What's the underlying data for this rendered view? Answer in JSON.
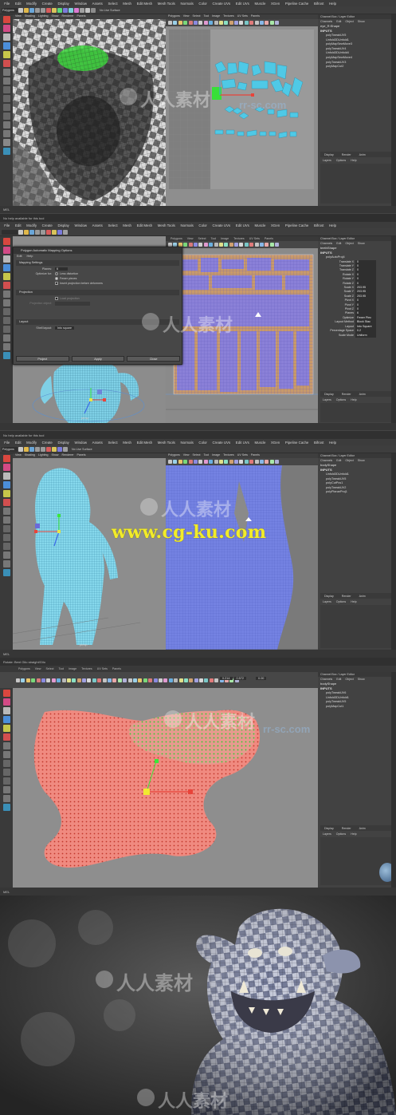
{
  "panel1": {
    "menus": [
      "File",
      "Edit",
      "Modify",
      "Create",
      "Display",
      "Window",
      "Assets",
      "Select",
      "Mesh",
      "Edit Mesh",
      "Mesh Tools",
      "Normals",
      "Color",
      "Create UVs",
      "Edit UVs",
      "Muscle",
      "XGen",
      "Pipeline Cache",
      "Bifrost",
      "Help"
    ],
    "mode_dropdown": "Polygons",
    "live_surface": "No Live Surface",
    "viewport_menus": [
      "View",
      "Shading",
      "Lighting",
      "Show",
      "Renderer",
      "Panels"
    ],
    "uv_menus": [
      "Polygons",
      "View",
      "Select",
      "Tool",
      "Image",
      "Textures",
      "UV Sets",
      "Panels"
    ],
    "channel_title": "Channel Box / Layer Editor",
    "channel_menus": [
      "Channels",
      "Edit",
      "Object",
      "Show"
    ],
    "object_name": "eye_R:Shape",
    "inputs_label": "INPUTS",
    "inputs": [
      "polyTweakUV5",
      "Unfold3DUnfold1",
      "polyMapSewMove3",
      "polyTweakUV4",
      "Unfold3DUnfold4",
      "polyMapSewMove4",
      "polyTweakUV3",
      "polyMapCut2"
    ],
    "layer_tabs": [
      "Display",
      "Render",
      "Anim"
    ],
    "layer_menus": [
      "Layers",
      "Options",
      "Help"
    ],
    "camera_label": "persp",
    "help_line": "No help available for this tool",
    "mel_label": "MEL"
  },
  "panel2": {
    "menus": [
      "File",
      "Edit",
      "Modify",
      "Create",
      "Display",
      "Window",
      "Assets",
      "Select",
      "Mesh",
      "Edit Mesh",
      "Mesh Tools",
      "Normals",
      "Color",
      "Create UVs",
      "Edit UVs",
      "Muscle",
      "XGen",
      "Pipeline Cache",
      "Bifrost",
      "Help"
    ],
    "dialog": {
      "title": "Polygon Automatic Mapping Options",
      "menus": [
        "Edit",
        "Help"
      ],
      "sections": [
        "Mapping Settings",
        "Projection",
        "Layout"
      ],
      "planes_label": "Planes:",
      "planes_value": "6",
      "optimize_label": "Optimize for:",
      "opt_less": "Less distortion",
      "opt_fewer": "Fewer pieces",
      "insert_label": "Insert projection before deformers",
      "load_projection": "Load projection",
      "projection_object": "Projection object:",
      "shell_layout_label": "Shell layout:",
      "shell_layout_value": "Into square",
      "buttons": [
        "Project",
        "Apply",
        "Close"
      ]
    },
    "object_name": "teethShape",
    "inputs_label": "INPUTS",
    "node": "polyAutoProj4",
    "attributes": [
      {
        "name": "Translate X",
        "value": "0"
      },
      {
        "name": "Translate Y",
        "value": "0"
      },
      {
        "name": "Translate Z",
        "value": "0"
      },
      {
        "name": "Rotate X",
        "value": "0"
      },
      {
        "name": "Rotate Y",
        "value": "0"
      },
      {
        "name": "Rotate Z",
        "value": "0"
      },
      {
        "name": "Scale X",
        "value": "203.95"
      },
      {
        "name": "Scale Y",
        "value": "203.95"
      },
      {
        "name": "Scale Z",
        "value": "203.95"
      },
      {
        "name": "Pivot X",
        "value": "0"
      },
      {
        "name": "Pivot Y",
        "value": "0"
      },
      {
        "name": "Pivot Z",
        "value": "0"
      },
      {
        "name": "Planes",
        "value": "6"
      },
      {
        "name": "Optimize",
        "value": "Fewer Piec"
      },
      {
        "name": "Layout Method",
        "value": "Block Stac"
      },
      {
        "name": "Layout",
        "value": "Into Square"
      },
      {
        "name": "Percentage Space",
        "value": "0.2"
      },
      {
        "name": "Scale Mode",
        "value": "Uniform"
      }
    ],
    "layer_tabs": [
      "Display",
      "Render",
      "Anim"
    ],
    "layer_menus": [
      "Layers",
      "Options",
      "Help"
    ],
    "camera_label": "persp",
    "help_line": "No help available for this tool"
  },
  "panel3": {
    "menus": [
      "File",
      "Edit",
      "Modify",
      "Create",
      "Display",
      "Window",
      "Assets",
      "Select",
      "Mesh",
      "Edit Mesh",
      "Mesh Tools",
      "Normals",
      "Color",
      "Create UVs",
      "Edit UVs",
      "Muscle",
      "XGen",
      "Pipeline Cache",
      "Bifrost",
      "Help"
    ],
    "mode_dropdown": "Polygons",
    "live_surface": "No Live Surface",
    "object_name": "bodyShape",
    "inputs_label": "INPUTS",
    "inputs": [
      "Unfold3DUnfold1",
      "polyTweakUV5",
      "polyCutPcs1",
      "polyTweakUV2",
      "polyPlanarProj1"
    ],
    "layer_tabs": [
      "Display",
      "Render",
      "Anim"
    ],
    "layer_menus": [
      "Layers",
      "Options",
      "Help"
    ],
    "camera_label": "persp",
    "mel_label": "MEL",
    "watermark_url": "www.cg-ku.com",
    "help_line": "Rotate: Bent Gilo straight/Gilo"
  },
  "panel4": {
    "uv_menus": [
      "Polygons",
      "View",
      "Select",
      "Tool",
      "Image",
      "Textures",
      "UV Sets",
      "Panels"
    ],
    "uv_field_u": "0.214",
    "uv_field_v": "0.572",
    "uv_field_w": "0.00",
    "object_name": "bodyShape",
    "inputs_label": "INPUTS",
    "inputs": [
      "polyTweakUV6",
      "Unfold3DUnfold1",
      "polyTweakUV5",
      "polyMapCut1"
    ],
    "layer_tabs": [
      "Display",
      "Render",
      "Anim"
    ],
    "layer_menus": [
      "Layers",
      "Options",
      "Help"
    ],
    "mel_label": "MEL"
  },
  "watermark": {
    "cn_text": "人人素材",
    "sc_text": "rr-sc.com"
  },
  "colors": {
    "menubar": "#3c3c3c",
    "viewport": "#8c8c8c",
    "uv_grid_blue": "#6f7fe0",
    "uv_shell_cyan": "#4ec8e8",
    "accent_green": "#37e337",
    "accent_red": "#e8443a",
    "url_yellow": "#f2ec2a"
  }
}
